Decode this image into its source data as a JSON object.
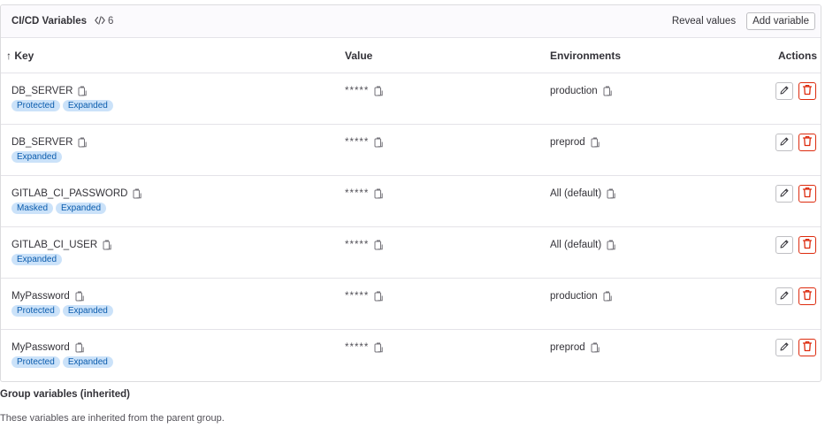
{
  "header": {
    "title": "CI/CD Variables",
    "count": "6",
    "reveal_label": "Reveal values",
    "add_label": "Add variable"
  },
  "table": {
    "columns": [
      "↑ Key",
      "Value",
      "Environments",
      "Actions"
    ],
    "rows": [
      {
        "key": "DB_SERVER",
        "value": "*****",
        "environment": "production",
        "badges": [
          "Protected",
          "Expanded"
        ]
      },
      {
        "key": "DB_SERVER",
        "value": "*****",
        "environment": "preprod",
        "badges": [
          "Expanded"
        ]
      },
      {
        "key": "GITLAB_CI_PASSWORD",
        "value": "*****",
        "environment": "All (default)",
        "badges": [
          "Masked",
          "Expanded"
        ]
      },
      {
        "key": "GITLAB_CI_USER",
        "value": "*****",
        "environment": "All (default)",
        "badges": [
          "Expanded"
        ]
      },
      {
        "key": "MyPassword",
        "value": "*****",
        "environment": "production",
        "badges": [
          "Protected",
          "Expanded"
        ]
      },
      {
        "key": "MyPassword",
        "value": "*****",
        "environment": "preprod",
        "badges": [
          "Protected",
          "Expanded"
        ]
      }
    ]
  },
  "group": {
    "title": "Group variables (inherited)",
    "description": "These variables are inherited from the parent group."
  },
  "icons": {
    "code": "code-icon",
    "copy": "copy-icon",
    "edit": "pencil-icon",
    "delete": "trash-icon"
  },
  "colors": {
    "badge_bg": "#cbe2f9",
    "badge_text": "#0b5cad",
    "danger": "#dd2b0e"
  }
}
